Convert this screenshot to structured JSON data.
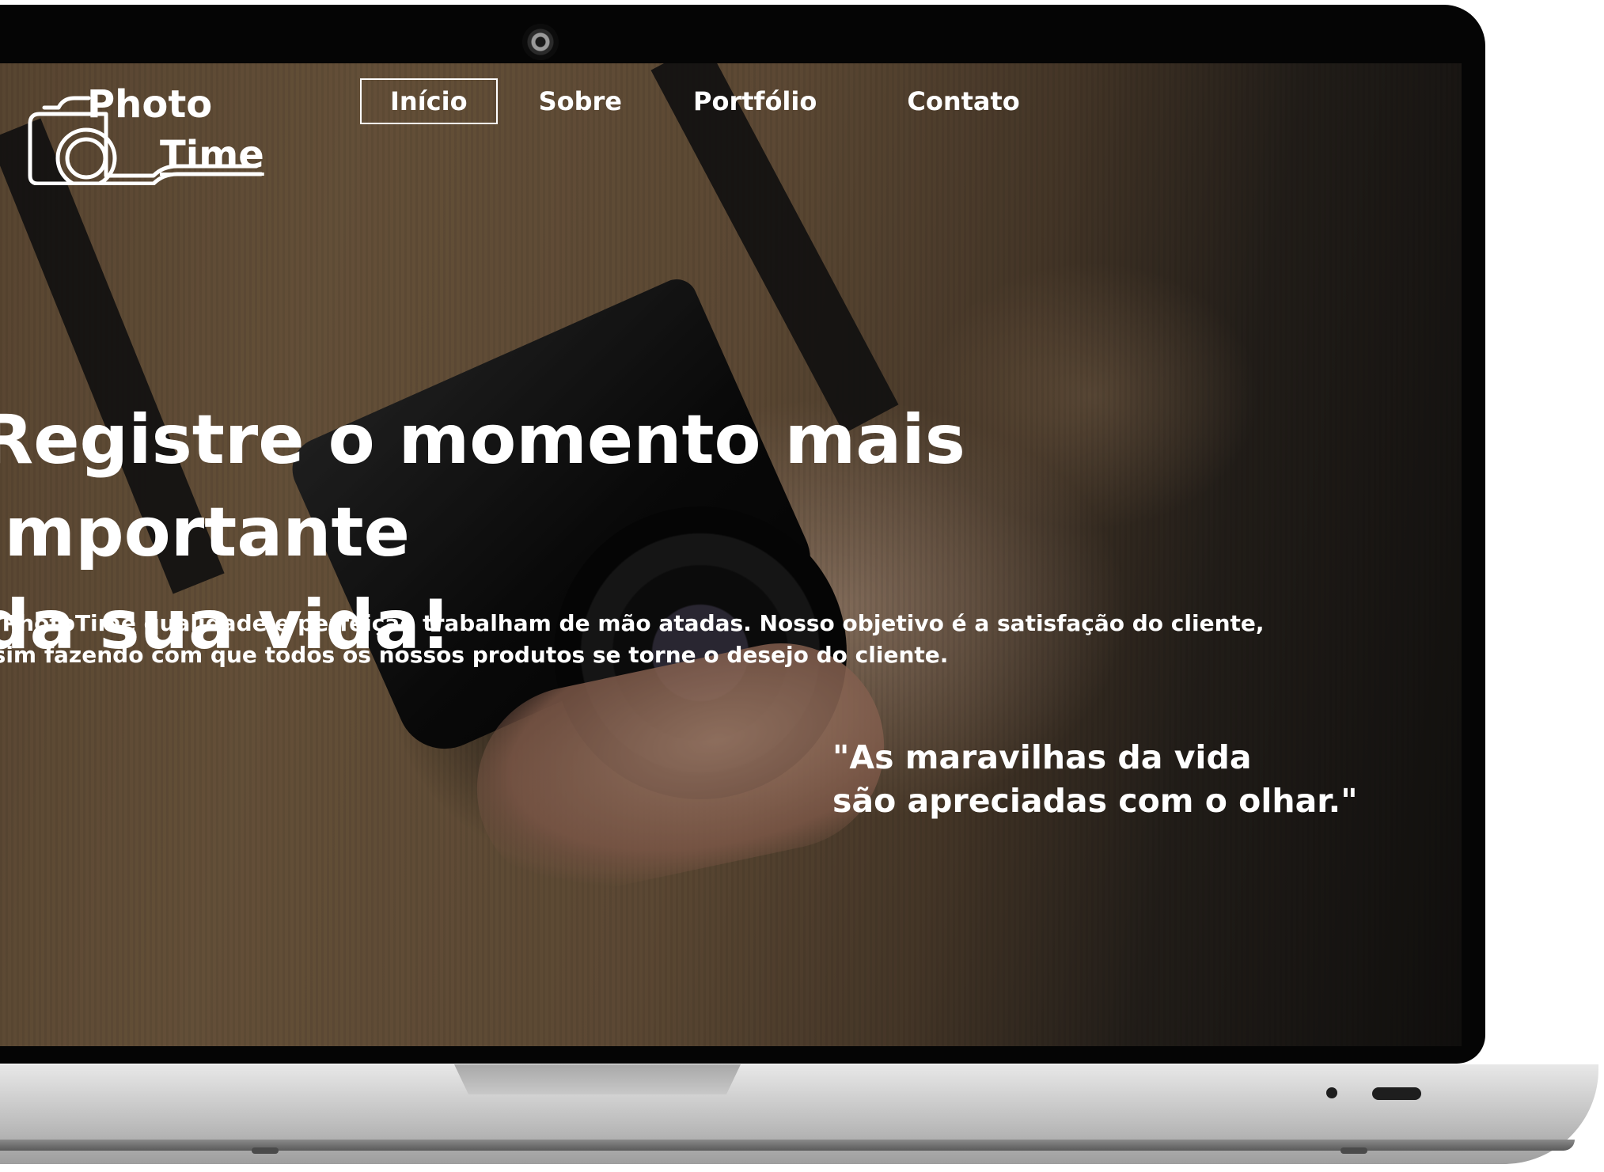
{
  "logo": {
    "line1": "Photo",
    "line2": "Time"
  },
  "nav": {
    "items": [
      {
        "label": "Início",
        "active": true
      },
      {
        "label": "Sobre",
        "active": false
      },
      {
        "label": "Portfólio",
        "active": false
      },
      {
        "label": "Contato",
        "active": false
      }
    ]
  },
  "hero": {
    "headline_line1": "Registre o momento mais importante",
    "headline_line2": "da sua vida!",
    "intro_line1": "a PhotoTime qualidade e perfeição trabalham de mão atadas. Nosso objetivo é a satisfação do cliente,",
    "intro_line2": "ssim fazendo com que todos os nossos produtos se torne o desejo do cliente.",
    "quote_line1": "\"As maravilhas da vida",
    "quote_line2": "são apreciadas com o olhar.\""
  },
  "icons": {
    "logo": "camera-outline-icon",
    "webcam": "webcam-icon"
  },
  "colors": {
    "text": "#ffffff",
    "bezel": "#050505",
    "chassis": "#cfcfcf"
  }
}
